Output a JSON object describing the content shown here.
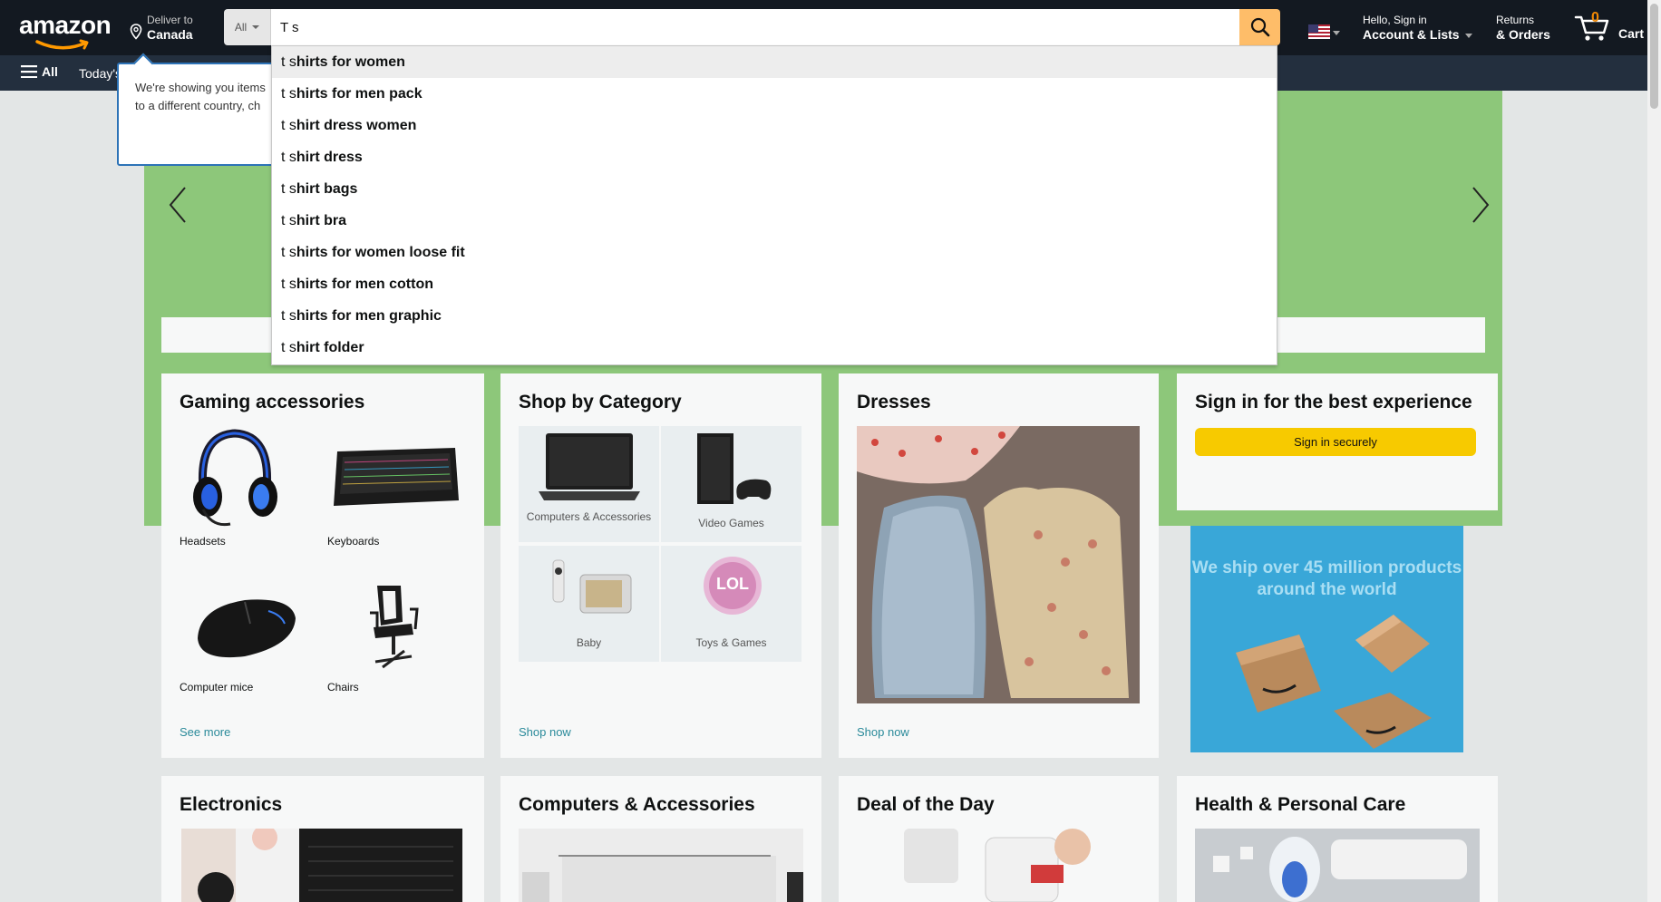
{
  "header": {
    "logo_text": "amazon",
    "deliver_line1": "Deliver to",
    "deliver_line2": "Canada",
    "search_category": "All",
    "search_value": "T s",
    "account_line1": "Hello, Sign in",
    "account_line2": "Account & Lists",
    "returns_line1": "Returns",
    "returns_line2": "& Orders",
    "cart_count": "0",
    "cart_label": "Cart"
  },
  "subnav": {
    "all_label": "All",
    "deals_label": "Today's"
  },
  "popover": {
    "line1": "We're showing you items",
    "line2": "to a different country, ch"
  },
  "suggestions": [
    {
      "prefix": "t s",
      "rest": "hirts for women"
    },
    {
      "prefix": "t s",
      "rest": "hirts for men pack"
    },
    {
      "prefix": "t s",
      "rest": "hirt dress women"
    },
    {
      "prefix": "t s",
      "rest": "hirt dress"
    },
    {
      "prefix": "t s",
      "rest": "hirt bags"
    },
    {
      "prefix": "t s",
      "rest": "hirt bra"
    },
    {
      "prefix": "t s",
      "rest": "hirts for women loose fit"
    },
    {
      "prefix": "t s",
      "rest": "hirts for men cotton"
    },
    {
      "prefix": "t s",
      "rest": "hirts for men graphic"
    },
    {
      "prefix": "t s",
      "rest": "hirt folder"
    }
  ],
  "cards": {
    "gaming": {
      "title": "Gaming accessories",
      "items": [
        "Headsets",
        "Keyboards",
        "Computer mice",
        "Chairs"
      ],
      "link": "See more"
    },
    "category": {
      "title": "Shop by Category",
      "items": [
        "Computers & Accessories",
        "Video Games",
        "Baby",
        "Toys & Games"
      ],
      "link": "Shop now"
    },
    "dresses": {
      "title": "Dresses",
      "link": "Shop now"
    },
    "signin": {
      "title": "Sign in for the best experience",
      "button": "Sign in securely"
    },
    "ship_banner": "We ship over 45 million products around the world",
    "electronics": {
      "title": "Electronics"
    },
    "computers": {
      "title": "Computers & Accessories"
    },
    "deal": {
      "title": "Deal of the Day"
    },
    "health": {
      "title": "Health & Personal Care"
    }
  },
  "colors": {
    "nav_dark": "#131921",
    "nav_sub": "#232f3e",
    "search_button": "#febd69",
    "cart_count": "#f08804",
    "signin_button": "#f7ca00",
    "hero_green": "#8dc77a",
    "link_teal": "#2a8a9a"
  }
}
